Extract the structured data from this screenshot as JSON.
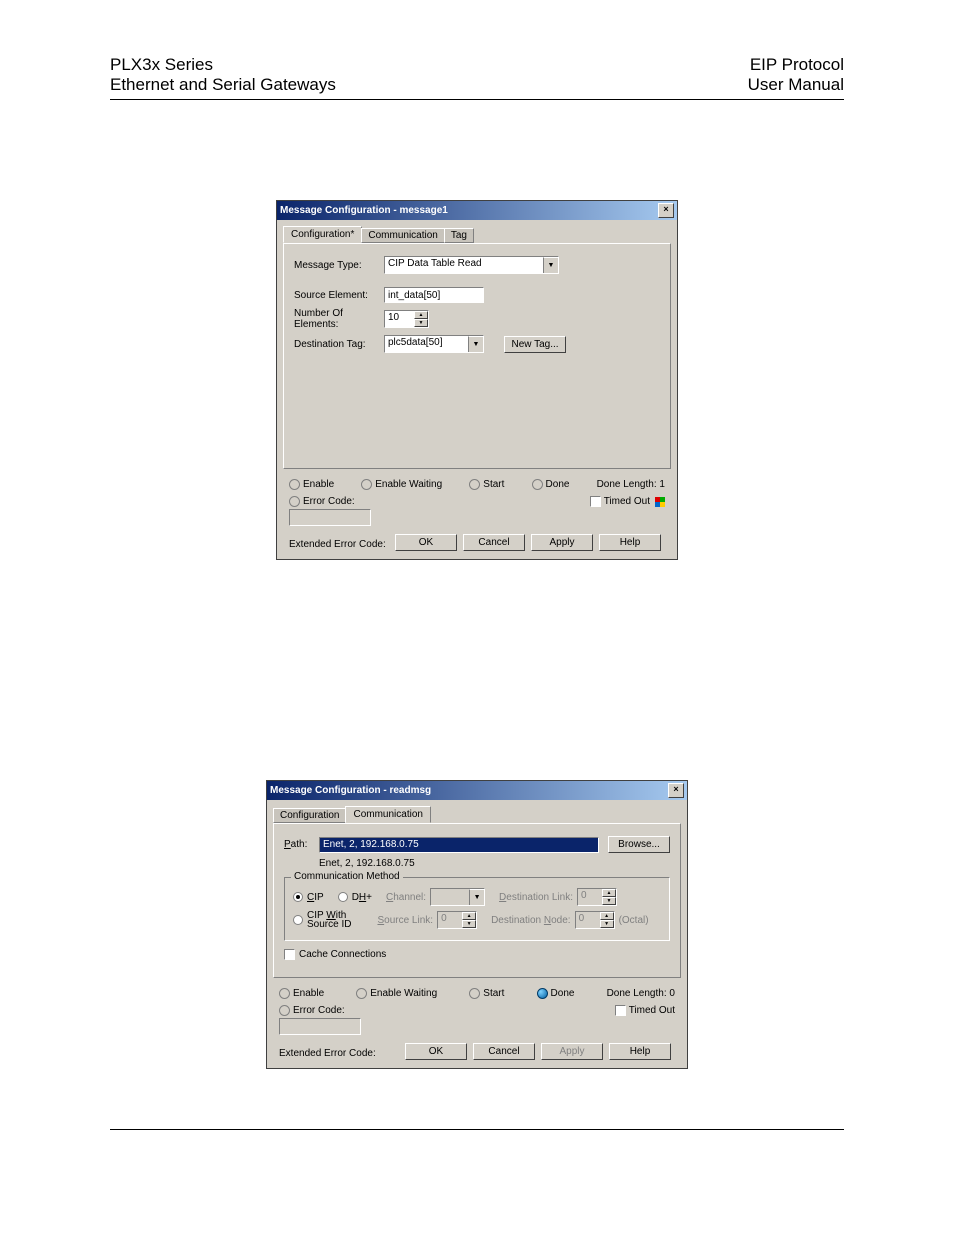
{
  "header": {
    "left1": "PLX3x Series",
    "left2": "Ethernet and Serial Gateways",
    "right1": "EIP Protocol",
    "right2": "User Manual"
  },
  "dialog1": {
    "title": "Message Configuration - message1",
    "tabs": {
      "config": "Configuration*",
      "comm": "Communication",
      "tag": "Tag"
    },
    "labels": {
      "messageType": "Message Type:",
      "sourceElement": "Source Element:",
      "numberOfElements": "Number Of Elements:",
      "destinationTag": "Destination Tag:"
    },
    "values": {
      "messageType": "CIP Data Table Read",
      "sourceElement": "int_data[50]",
      "numberOfElements": "10",
      "destinationTag": "plc5data[50]"
    },
    "newTag": "New Tag...",
    "status": {
      "enable": "Enable",
      "enableWaiting": "Enable Waiting",
      "start": "Start",
      "done": "Done",
      "doneLength": "Done Length: 1",
      "errorCode": "Error Code:",
      "timedOut": "Timed Out",
      "extended": "Extended Error Code:"
    },
    "buttons": {
      "ok": "OK",
      "cancel": "Cancel",
      "apply": "Apply",
      "help": "Help"
    }
  },
  "dialog2": {
    "title": "Message Configuration - readmsg",
    "tabs": {
      "config": "Configuration",
      "comm": "Communication"
    },
    "labels": {
      "path": "Path:",
      "commMethod": "Communication Method",
      "cip": "CIP",
      "dh": "DH+",
      "cipWith": "CIP With\nSource ID",
      "channel": "Channel:",
      "sourceLink": "Source Link:",
      "destLink": "Destination Link:",
      "destNode": "Destination Node:",
      "octal": "(Octal)",
      "cache": "Cache Connections"
    },
    "values": {
      "path": "Enet, 2, 192.168.0.75",
      "pathEcho": "Enet, 2, 192.168.0.75",
      "sourceLink": "0",
      "destLink": "0",
      "destNode": "0"
    },
    "browse": "Browse...",
    "status": {
      "enable": "Enable",
      "enableWaiting": "Enable Waiting",
      "start": "Start",
      "done": "Done",
      "doneLength": "Done Length: 0",
      "errorCode": "Error Code:",
      "timedOut": "Timed Out",
      "extended": "Extended Error Code:"
    },
    "buttons": {
      "ok": "OK",
      "cancel": "Cancel",
      "apply": "Apply",
      "help": "Help"
    }
  }
}
